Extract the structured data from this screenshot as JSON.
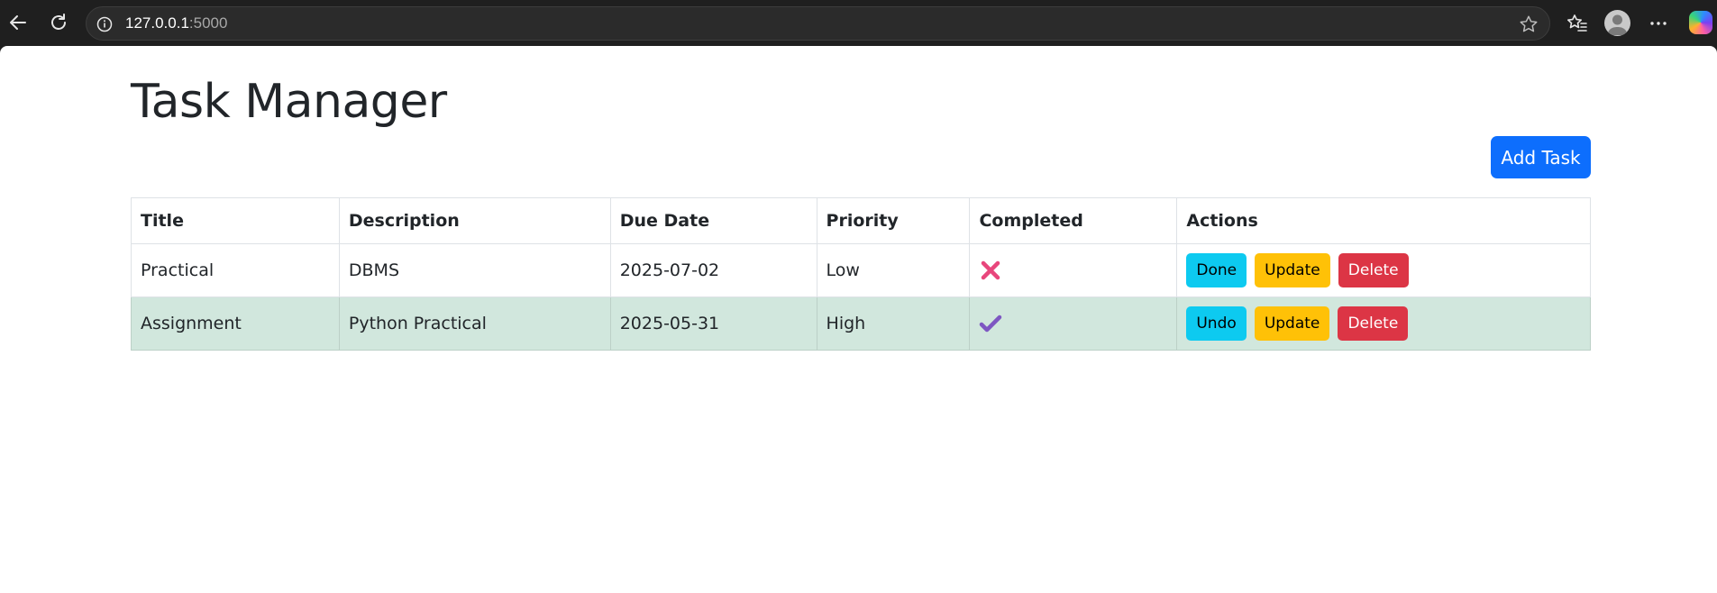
{
  "browser": {
    "url_host": "127.0.0.1",
    "url_port": ":5000"
  },
  "page": {
    "title": "Task Manager",
    "add_button_label": "Add Task"
  },
  "table": {
    "headers": [
      "Title",
      "Description",
      "Due Date",
      "Priority",
      "Completed",
      "Actions"
    ],
    "rows": [
      {
        "title": "Practical",
        "description": "DBMS",
        "due_date": "2025-07-02",
        "priority": "Low",
        "completed": false,
        "completed_icon": "cross-mark-icon",
        "toggle_label": "Done",
        "update_label": "Update",
        "delete_label": "Delete"
      },
      {
        "title": "Assignment",
        "description": "Python Practical",
        "due_date": "2025-05-31",
        "priority": "High",
        "completed": true,
        "completed_icon": "check-mark-icon",
        "toggle_label": "Undo",
        "update_label": "Update",
        "delete_label": "Delete"
      }
    ]
  },
  "colors": {
    "primary": "#0d6efd",
    "info": "#0dcaf0",
    "warning": "#ffc107",
    "danger": "#dc3545",
    "success_row": "#d1e7dd",
    "cross": "#e8467c",
    "check": "#7e57c2"
  }
}
